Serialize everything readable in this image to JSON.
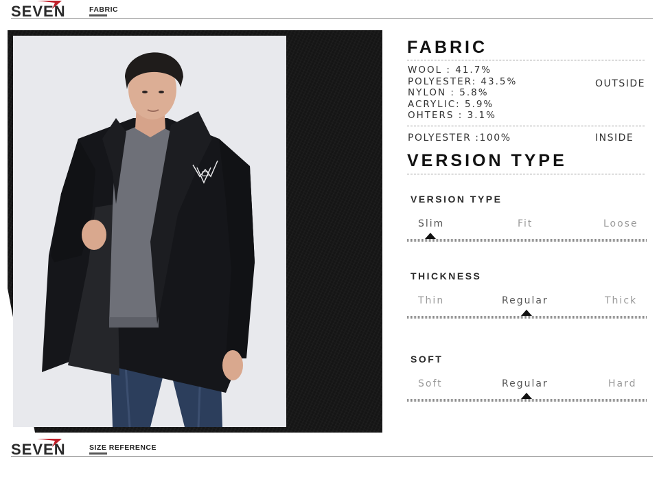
{
  "brand": {
    "logo_text": "SEVEN",
    "colors": {
      "logo_accent": "#c0202a",
      "logo_text": "#2a2a2a"
    }
  },
  "header_top": {
    "section_label": "FABRIC"
  },
  "header_bottom": {
    "section_label": "SIZE REFERENCE"
  },
  "fabric": {
    "heading": "FABRIC",
    "outside_composition": [
      "WOOL : 41.7%",
      "POLYESTER: 43.5%",
      "NYLON : 5.8%",
      "ACRYLIC: 5.9%",
      "OHTERS : 3.1%"
    ],
    "outside_label": "OUTSIDE",
    "inside_composition": "POLYESTER :100%",
    "inside_label": "INSIDE"
  },
  "version_heading": "VERSION TYPE",
  "scales": [
    {
      "title": "VERSION TYPE",
      "options": [
        "Slim",
        "Fit",
        "Loose"
      ],
      "selected": "Slim"
    },
    {
      "title": "THICKNESS",
      "options": [
        "Thin",
        "Regular",
        "Thick"
      ],
      "selected": "Regular"
    },
    {
      "title": "SOFT",
      "options": [
        "Soft",
        "Regular",
        "Hard"
      ],
      "selected": "Regular"
    }
  ],
  "photo": {
    "subject": "product-photo-man-black-wool-coat"
  }
}
